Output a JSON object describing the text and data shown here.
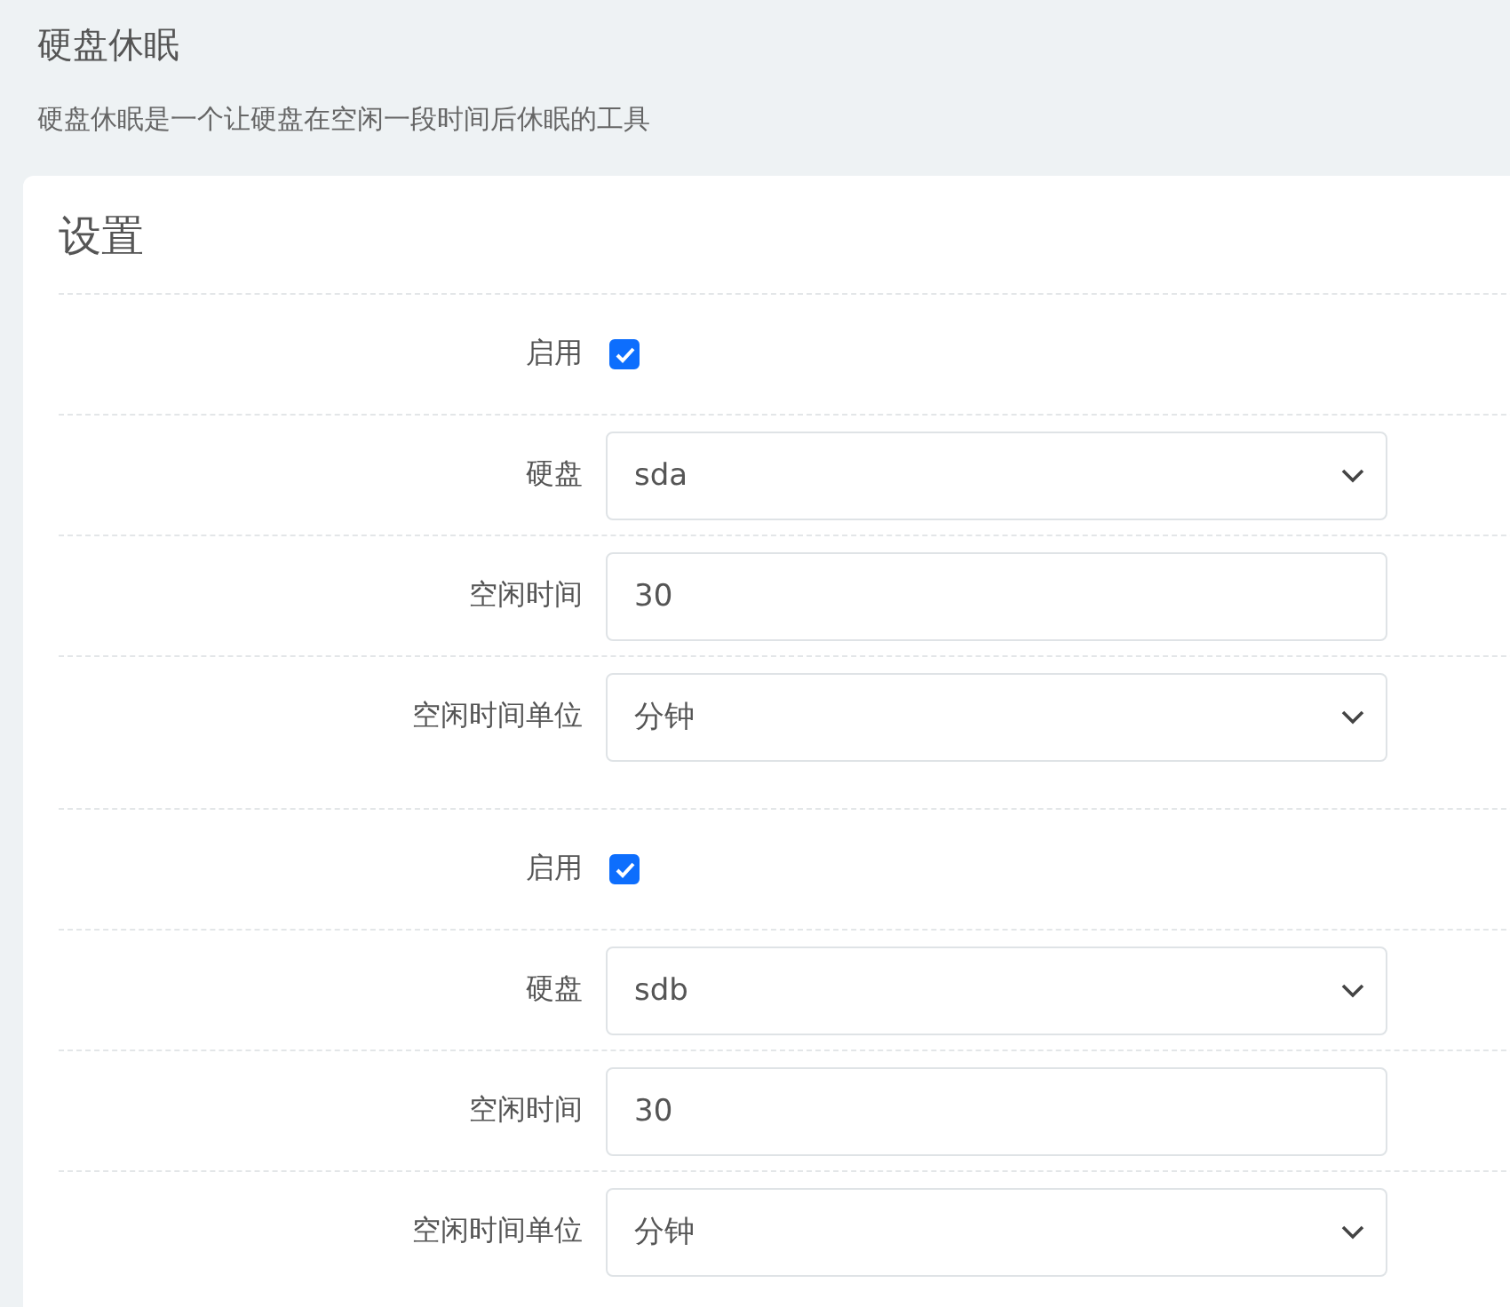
{
  "page": {
    "title": "硬盘休眠",
    "description": "硬盘休眠是一个让硬盘在空闲一段时间后休眠的工具"
  },
  "card": {
    "title": "设置",
    "sections": [
      {
        "fields": [
          {
            "kind": "checkbox",
            "label": "启用",
            "checked": true
          },
          {
            "kind": "select",
            "label": "硬盘",
            "value": "sda"
          },
          {
            "kind": "text",
            "label": "空闲时间",
            "value": "30"
          },
          {
            "kind": "select",
            "label": "空闲时间单位",
            "value": "分钟"
          }
        ]
      },
      {
        "fields": [
          {
            "kind": "checkbox",
            "label": "启用",
            "checked": true
          },
          {
            "kind": "select",
            "label": "硬盘",
            "value": "sdb"
          },
          {
            "kind": "text",
            "label": "空闲时间",
            "value": "30"
          },
          {
            "kind": "select",
            "label": "空闲时间单位",
            "value": "分钟"
          }
        ]
      }
    ]
  }
}
